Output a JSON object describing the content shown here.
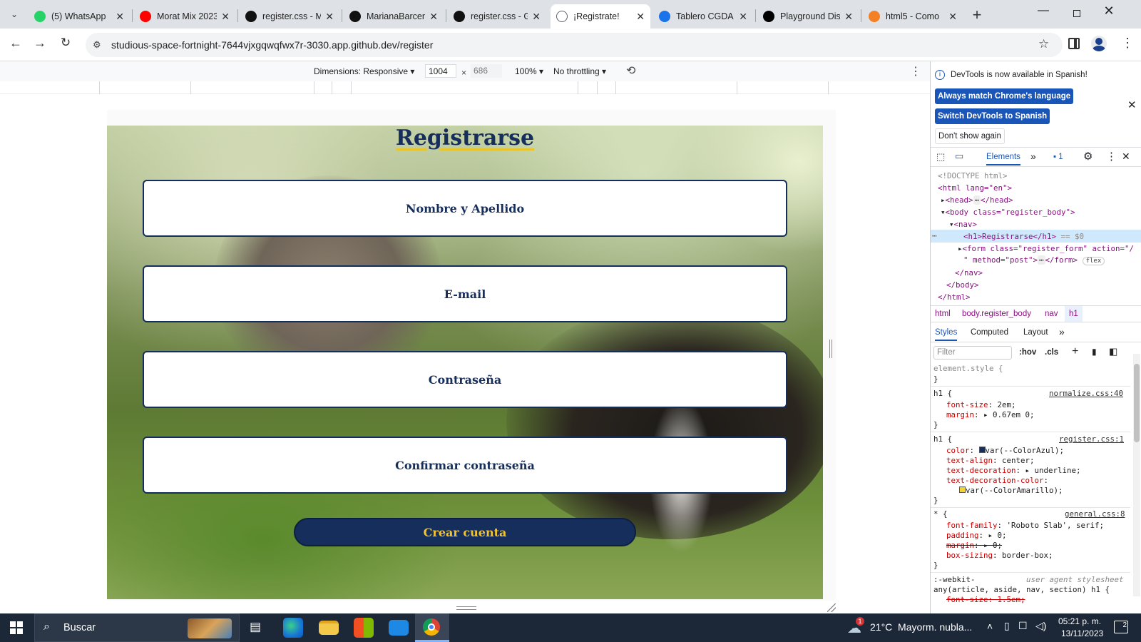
{
  "tabs": [
    {
      "title": "(5) WhatsApp",
      "icon": "whatsapp-icon",
      "color": "#25d366"
    },
    {
      "title": "Morat Mix 2023",
      "icon": "youtube-icon",
      "color": "#ff0000"
    },
    {
      "title": "register.css - M",
      "icon": "github-icon",
      "color": "#111111"
    },
    {
      "title": "MarianaBarcen",
      "icon": "github-icon",
      "color": "#111111"
    },
    {
      "title": "register.css - G",
      "icon": "github-icon",
      "color": "#111111"
    },
    {
      "title": "¡Registrate!",
      "icon": "globe-icon",
      "color": "#5f6368"
    },
    {
      "title": "Tablero CGDA",
      "icon": "diamond-icon",
      "color": "#1a73e8"
    },
    {
      "title": "Playground Dis",
      "icon": "terminal-icon",
      "color": "#000000"
    },
    {
      "title": "html5 - Como",
      "icon": "stackoverflow-icon",
      "color": "#f48024"
    }
  ],
  "address": {
    "url": "studious-space-fortnight-7644vjxgqwqfwx7r-3030.app.github.dev/register"
  },
  "device_toolbar": {
    "dimensions_label": "Dimensions: Responsive",
    "width": "1004",
    "times": "×",
    "height": "686",
    "zoom": "100%",
    "throttling": "No throttling"
  },
  "page": {
    "title": "Registrarse",
    "fields": [
      "Nombre y Apellido",
      "E-mail",
      "Contraseña",
      "Confirmar contraseña"
    ],
    "submit_label": "Crear cuenta",
    "colors": {
      "azul": "#162e5c",
      "amarillo": "#f2c230"
    }
  },
  "devtools": {
    "banner_text": "DevTools is now available in Spanish!",
    "btn_match": "Always match Chrome's language",
    "btn_switch": "Switch DevTools to Spanish",
    "btn_dont": "Don't show again",
    "tab_elements": "Elements",
    "issues_count": "1",
    "dom": {
      "doctype": "<!DOCTYPE html>",
      "html_open": "<html lang=\"en\">",
      "head": "<head>",
      "head_end": "</head>",
      "body_open": "<body class=\"register_body\">",
      "nav_open": "<nav>",
      "h1_line": "<h1>Registrarse</h1>",
      "h1_eq": "== $0",
      "form_line1": "<form class=\"register_form\" action=\"/",
      "form_line2": "\" method=\"post\">",
      "form_end": "</form>",
      "flex_badge": "flex",
      "nav_close": "</nav>",
      "body_close": "</body>",
      "html_close": "</html>"
    },
    "breadcrumbs": [
      "html",
      "body.register_body",
      "nav",
      "h1"
    ],
    "subtabs": [
      "Styles",
      "Computed",
      "Layout"
    ],
    "filter_placeholder": "Filter",
    "hov": ":hov",
    "cls": ".cls",
    "styles": {
      "element_style": "element.style {",
      "close": "}",
      "rule1_sel": "h1 {",
      "rule1_src": "normalize.css:40",
      "rule1_p1": "font-size",
      "rule1_v1": "2em;",
      "rule1_p2": "margin",
      "rule1_v2": "0.67em 0;",
      "rule2_sel": "h1 {",
      "rule2_src": "register.css:1",
      "rule2_p1": "color",
      "rule2_v1": "var(--ColorAzul);",
      "rule2_p2": "text-align",
      "rule2_v2": "center;",
      "rule2_p3": "text-decoration",
      "rule2_v3": "underline;",
      "rule2_p4": "text-decoration-color",
      "rule2_v4": "var(--ColorAmarillo);",
      "rule3_sel": "* {",
      "rule3_src": "general.css:8",
      "rule3_p1": "font-family",
      "rule3_v1": "'Roboto Slab', serif;",
      "rule3_p2": "padding",
      "rule3_v2": "0;",
      "rule3_p3": "margin",
      "rule3_v3": "0;",
      "rule3_p4": "box-sizing",
      "rule3_v4": "border-box;",
      "rule4_sel": ":-webkit-",
      "rule4_src": "user agent stylesheet",
      "rule4_sel2": "any(article, aside, nav, section) h1 {",
      "rule4_p1": "font-size: 1.5em;"
    }
  },
  "taskbar": {
    "search": "Buscar",
    "weather": "21°C  Mayorm. nubla...",
    "time": "05:21 p. m.",
    "date": "13/11/2023",
    "notif_count": "2",
    "weather_badge": "1"
  }
}
